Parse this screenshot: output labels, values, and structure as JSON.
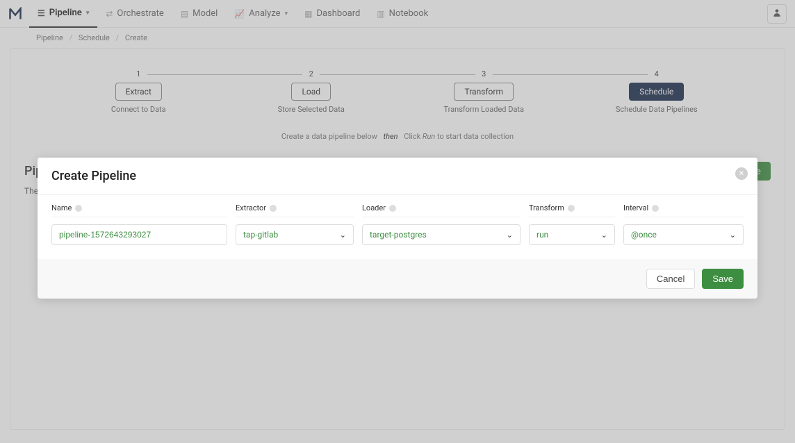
{
  "nav": {
    "items": [
      {
        "label": "Pipeline",
        "active": true,
        "dropdown": true
      },
      {
        "label": "Orchestrate"
      },
      {
        "label": "Model"
      },
      {
        "label": "Analyze",
        "dropdown": true
      },
      {
        "label": "Dashboard"
      },
      {
        "label": "Notebook"
      }
    ]
  },
  "breadcrumbs": [
    "Pipeline",
    "Schedule",
    "Create"
  ],
  "stepper": [
    {
      "num": "1",
      "label": "Extract",
      "sub": "Connect to Data"
    },
    {
      "num": "2",
      "label": "Load",
      "sub": "Store Selected Data"
    },
    {
      "num": "3",
      "label": "Transform",
      "sub": "Transform Loaded Data"
    },
    {
      "num": "4",
      "label": "Schedule",
      "sub": "Schedule Data Pipelines",
      "active": true
    }
  ],
  "hint": {
    "pre": "Create a data pipeline below",
    "then": "then",
    "click": "Click",
    "run": "Run",
    "post": "to start data collection"
  },
  "pipelines": {
    "heading": "Pipelines",
    "create": "Create",
    "empty": "There are no pipelines scheduled yet."
  },
  "modal": {
    "title": "Create Pipeline",
    "fields": {
      "name": {
        "label": "Name",
        "value": "pipeline-1572643293027"
      },
      "extractor": {
        "label": "Extractor",
        "value": "tap-gitlab"
      },
      "loader": {
        "label": "Loader",
        "value": "target-postgres"
      },
      "transform": {
        "label": "Transform",
        "value": "run"
      },
      "interval": {
        "label": "Interval",
        "value": "@once"
      }
    },
    "cancel": "Cancel",
    "save": "Save"
  }
}
